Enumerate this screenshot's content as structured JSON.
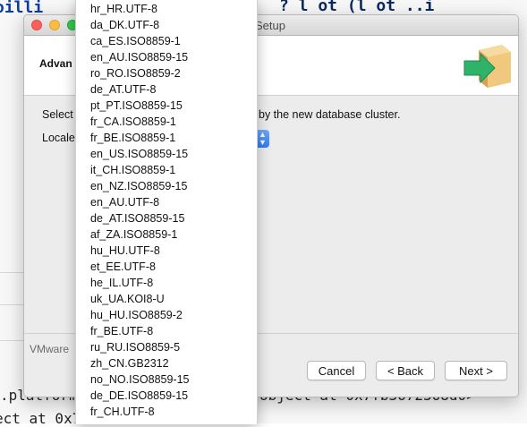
{
  "background": {
    "top_code_left": "oilli",
    "top_code_right": "?  l  ot  (l  ot  ..i",
    "bottom_line_1": ".platform.a",
    "bottom_line_1_end": "object at 0x7fb3672368d0>",
    "bottom_line_2": "ect at 0x7f"
  },
  "window": {
    "title": "Setup",
    "header_title": "Advan",
    "description_start": "Select",
    "description_end": "by the new database cluster.",
    "locale_label": "Locale",
    "footer_brand": "VMware",
    "buttons": {
      "cancel": "Cancel",
      "back": "< Back",
      "next": "Next >"
    }
  },
  "dropdown": {
    "items": [
      "hr_HR.UTF-8",
      "da_DK.UTF-8",
      "ca_ES.ISO8859-1",
      "en_AU.ISO8859-15",
      "ro_RO.ISO8859-2",
      "de_AT.UTF-8",
      "pt_PT.ISO8859-15",
      "fr_CA.ISO8859-1",
      "fr_BE.ISO8859-1",
      "en_US.ISO8859-15",
      "it_CH.ISO8859-1",
      "en_NZ.ISO8859-15",
      "en_AU.UTF-8",
      "de_AT.ISO8859-15",
      "af_ZA.ISO8859-1",
      "hu_HU.UTF-8",
      "et_EE.UTF-8",
      "he_IL.UTF-8",
      "uk_UA.KOI8-U",
      "hu_HU.ISO8859-2",
      "fr_BE.UTF-8",
      "ru_RU.ISO8859-5",
      "zh_CN.GB2312",
      "no_NO.ISO8859-15",
      "de_DE.ISO8859-15",
      "fr_CH.UTF-8"
    ]
  }
}
